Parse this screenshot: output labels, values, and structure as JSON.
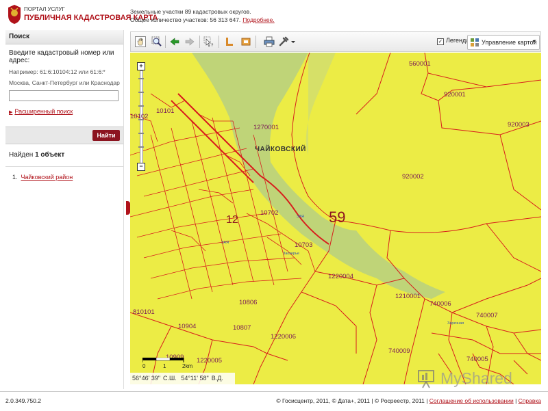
{
  "header": {
    "portal_small": "ПОРТАЛ УСЛУГ",
    "portal_big": "ПУБЛИЧНАЯ КАДАСТРОВАЯ КАРТА",
    "info_line1": "Земельные участки 89 кадастровых округов.",
    "info_line2": "Общее количество участков: 56 313 647.",
    "more_link": "Подробнее."
  },
  "sidebar": {
    "search_header": "Поиск",
    "search_title": "Введите кадастровый номер или адрес:",
    "hint1": "Например: 61:6:10104:12 или 61:6:*",
    "hint2": "Москва, Санкт-Петербург или Краснодар",
    "search_value": "",
    "advanced_search": "Расширенный поиск",
    "find_button": "Найти",
    "results_prefix": "Найден ",
    "results_count": "1 объект",
    "results": [
      {
        "index": "1.",
        "label": "Чайковский район"
      }
    ]
  },
  "toolbar": {
    "legend_label": "Легенда",
    "legend_checked": true,
    "map_control_label": "Управление картой",
    "icons": [
      "pan-hand-icon",
      "zoom-box-icon",
      "back-arrow-icon",
      "forward-arrow-icon",
      "identify-icon",
      "measure-icon",
      "area-icon",
      "print-icon",
      "tools-icon"
    ]
  },
  "map": {
    "city_label": "ЧАЙКОВСКИЙ",
    "district_number": "59",
    "subdistrict_number": "12",
    "cadastral_labels": [
      "560001",
      "920001",
      "920003",
      "920002",
      "10101",
      "10102",
      "1270001",
      "10702",
      "10703",
      "1220004",
      "1210001",
      "740006",
      "740007",
      "10806",
      "810101",
      "10904",
      "10807",
      "1220006",
      "740009",
      "740005",
      "1220005",
      "10909"
    ],
    "small_labels": [
      "ЗАЯ",
      "ЗАЯ",
      "Заозерье",
      "Заречная"
    ],
    "scale": {
      "labels": [
        "0",
        "1",
        "2km"
      ]
    },
    "coords": {
      "lat": "56°46' 39\"",
      "lat_hemi": "С.Ш.",
      "lon": "54°11' 58\"",
      "lon_hemi": "В.Д."
    },
    "colors": {
      "land": "#ecec45",
      "water": "#bfd478",
      "boundary": "#d81c1c"
    }
  },
  "footer": {
    "version": "2.0.349.750.2",
    "copyright": "© Госисцентр, 2011, © Дата+, 2011 | © Росреестр, 2011 | ",
    "agreement": "Соглашение об использовании",
    "separator": " | ",
    "help": "Справка"
  },
  "watermark": {
    "text": "MyShared"
  }
}
